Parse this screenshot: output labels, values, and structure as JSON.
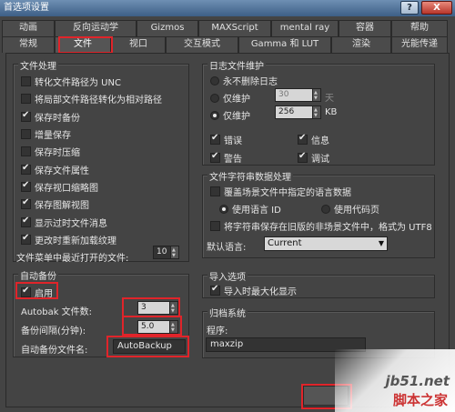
{
  "window": {
    "title": "首选项设置",
    "help_label": "?",
    "close_label": "X"
  },
  "tabs": {
    "row1": [
      "动画",
      "反向运动学",
      "Gizmos",
      "MAXScript",
      "mental ray",
      "容器",
      "帮助"
    ],
    "row2": [
      "常规",
      "文件",
      "视口",
      "交互模式",
      "Gamma 和 LUT",
      "渲染",
      "光能传递"
    ],
    "active": "文件"
  },
  "file_handling": {
    "title": "文件处理",
    "items": [
      {
        "label": "转化文件路径为 UNC",
        "checked": false
      },
      {
        "label": "将局部文件路径转化为相对路径",
        "checked": false
      },
      {
        "label": "保存时备份",
        "checked": true
      },
      {
        "label": "增量保存",
        "checked": false
      },
      {
        "label": "保存时压缩",
        "checked": false
      },
      {
        "label": "保存文件属性",
        "checked": true
      },
      {
        "label": "保存视口缩略图",
        "checked": true
      },
      {
        "label": "保存图解视图",
        "checked": true
      },
      {
        "label": "显示过时文件消息",
        "checked": true
      },
      {
        "label": "更改时重新加载纹理",
        "checked": true
      }
    ],
    "recent_label": "文件菜单中最近打开的文件:",
    "recent_value": "10"
  },
  "log": {
    "title": "日志文件维护",
    "options": [
      {
        "label": "永不删除日志",
        "selected": false
      },
      {
        "label": "仅维护",
        "selected": false,
        "value": "30",
        "unit": "天"
      },
      {
        "label": "仅维护",
        "selected": true,
        "value": "256",
        "unit": "KB"
      }
    ],
    "checks": [
      {
        "label": "错误",
        "checked": true
      },
      {
        "label": "信息",
        "checked": true
      },
      {
        "label": "警告",
        "checked": true
      },
      {
        "label": "调试",
        "checked": true
      }
    ]
  },
  "string_data": {
    "title": "文件字符串数据处理",
    "override_label": "覆盖场景文件中指定的语言数据",
    "use_language_id": "使用语言 ID",
    "use_codepage": "使用代码页",
    "save_legacy_label": "将字符串保存在旧版的非场景文件中，格式为 UTF8",
    "default_language_label": "默认语言:",
    "default_language_value": "Current"
  },
  "auto_backup": {
    "title": "自动备份",
    "enable_label": "启用",
    "enabled": true,
    "count_label": "Autobak 文件数:",
    "count_value": "3",
    "interval_label": "备份间隔(分钟):",
    "interval_value": "5.0",
    "name_label": "自动备份文件名:",
    "name_value": "AutoBackup"
  },
  "import": {
    "title": "导入选项",
    "maximize_label": "导入时最大化显示",
    "maximize_checked": true
  },
  "archive": {
    "title": "归档系统",
    "program_label": "程序:",
    "program_value": "maxzip"
  },
  "watermark": {
    "url": "jb51.net",
    "name": "脚本之家"
  },
  "colors": {
    "highlight": "#e0242a",
    "panel": "#444444"
  }
}
